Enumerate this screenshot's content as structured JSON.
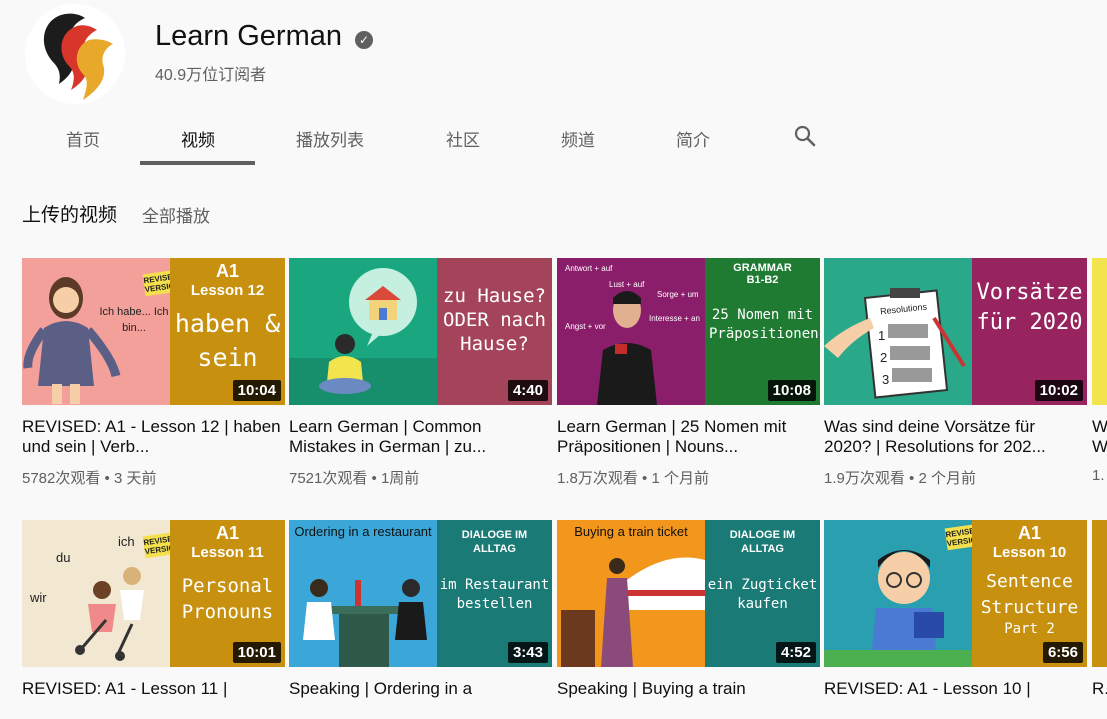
{
  "channel": {
    "name": "Learn German",
    "subscribers": "40.9万位订阅者",
    "colors": {
      "black": "#1c1c1c",
      "red": "#d9362b",
      "gold": "#e8a92a"
    }
  },
  "tabs": [
    {
      "label": "首页",
      "active": false
    },
    {
      "label": "视频",
      "active": true
    },
    {
      "label": "播放列表",
      "active": false
    },
    {
      "label": "社区",
      "active": false
    },
    {
      "label": "频道",
      "active": false
    },
    {
      "label": "简介",
      "active": false
    }
  ],
  "section": {
    "title": "上传的视频",
    "play_all": "全部播放"
  },
  "videos_row1": [
    {
      "title": "REVISED: A1 - Lesson 12 | haben und sein | Verb...",
      "views": "5782次观看",
      "age": "3 天前",
      "duration": "10:04",
      "thumb": {
        "left_bg": "#f4a09a",
        "right_bg": "#c8900f",
        "badge": "REVISED VERSION",
        "level": "A1",
        "lesson": "Lesson 12",
        "text": "haben & sein",
        "bubble": "Ich habe... Ich bin..."
      }
    },
    {
      "title": "Learn German | Common Mistakes in German | zu...",
      "views": "7521次观看",
      "age": "1周前",
      "duration": "4:40",
      "thumb": {
        "left_bg": "#1aa67f",
        "right_bg": "#a4445a",
        "text": "zu Hause? ODER nach Hause?"
      }
    },
    {
      "title": "Learn German | 25 Nomen mit Präpositionen | Nouns...",
      "views": "1.8万次观看",
      "age": "1 个月前",
      "duration": "10:08",
      "thumb": {
        "left_bg": "#8b1e6a",
        "right_bg": "#1f7a32",
        "label": "GRAMMAR",
        "sub": "B1-B2",
        "text": "25 Nomen mit Präpositionen",
        "notes": [
          "Antwort + auf",
          "Lust + auf",
          "Sorge + um",
          "Interesse + an",
          "Angst + vor"
        ]
      }
    },
    {
      "title": "Was sind deine Vorsätze für 2020? | Resolutions for 202...",
      "views": "1.9万次观看",
      "age": "2 个月前",
      "duration": "10:02",
      "thumb": {
        "left_bg": "#2aa88a",
        "right_bg": "#98245f",
        "text": "Vorsätze für 2020",
        "paper_title": "Resolutions",
        "numbers": [
          "1",
          "2",
          "3"
        ]
      }
    },
    {
      "title": "W... W...",
      "views": "1."
    }
  ],
  "videos_row2": [
    {
      "title": "REVISED: A1 - Lesson 11 |",
      "duration": "10:01",
      "thumb": {
        "left_bg": "#f2e8d2",
        "right_bg": "#c8900f",
        "badge": "REVISED VERSION",
        "level": "A1",
        "lesson": "Lesson 11",
        "text": "Personal Pronouns",
        "words": [
          "ich",
          "du",
          "wir"
        ]
      }
    },
    {
      "title": "Speaking | Ordering in a",
      "duration": "3:43",
      "thumb": {
        "left_bg": "#3aa7d8",
        "right_bg": "#1a7a76",
        "caption": "Ordering in a restaurant",
        "label": "DIALOGE IM ALLTAG",
        "text": "im Restaurant bestellen"
      }
    },
    {
      "title": "Speaking | Buying a train",
      "duration": "4:52",
      "thumb": {
        "left_bg": "#f2961c",
        "right_bg": "#1a7a76",
        "caption": "Buying a train ticket",
        "label": "DIALOGE IM ALLTAG",
        "text": "ein Zugticket kaufen"
      }
    },
    {
      "title": "REVISED: A1 - Lesson 10 |",
      "duration": "6:56",
      "thumb": {
        "left_bg": "#2a9fb0",
        "right_bg": "#c8900f",
        "badge": "REVISED VERSION",
        "level": "A1",
        "lesson": "Lesson 10",
        "text": "Sentence Structure",
        "part": "Part 2"
      }
    },
    {
      "title": "R..."
    }
  ]
}
